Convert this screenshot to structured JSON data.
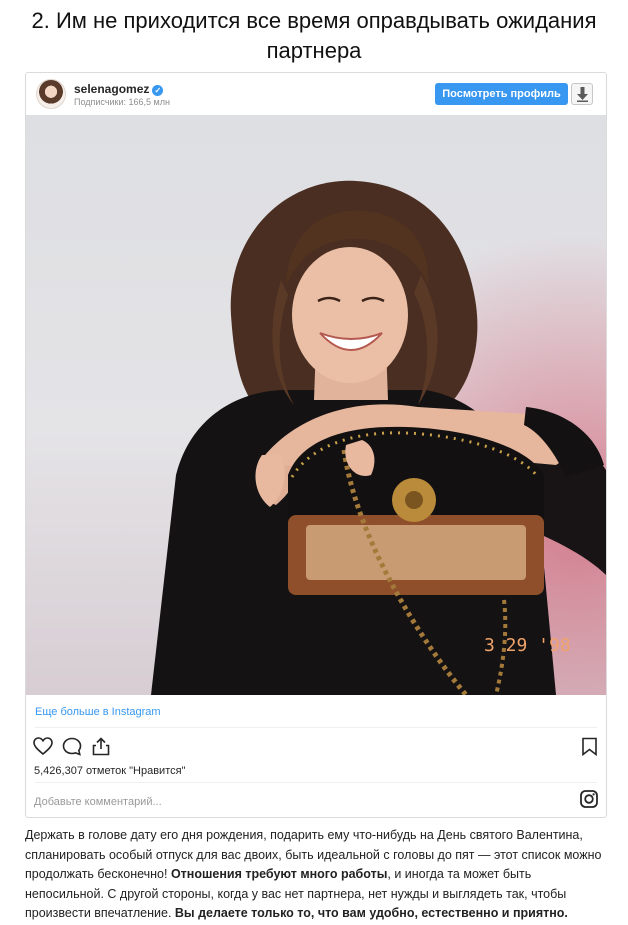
{
  "article": {
    "heading": "2. Им не приходится все время оправдывать ожидания партнера",
    "paragraph": {
      "part1": "Держать в голове дату его дня рождения, подарить ему что-нибудь на День святого Валентина, спланировать особый отпуск для вас двоих, быть идеальной с головы до пят — этот список можно продолжать бесконечно! ",
      "bold1": "Отношения требуют много работы",
      "part2": ", и иногда та может быть непосильной. С другой стороны, когда у вас нет партнера, нет нужды и выглядеть так, чтобы произвести впечатление. ",
      "bold2": "Вы делаете только то, что вам удобно, естественно и приятно."
    }
  },
  "embed": {
    "username": "selenagomez",
    "followers": "Подписчики: 166,5 млн",
    "view_profile_label": "Посмотреть профиль",
    "photo_stamp": "3 29 '98",
    "more_link": "Еще больше в Instagram",
    "likes": "5,426,307 отметок \"Нравится\"",
    "comment_placeholder": "Добавьте комментарий...",
    "icons": [
      "verified-icon",
      "download-icon",
      "heart-icon",
      "comment-icon",
      "share-icon",
      "bookmark-icon",
      "instagram-glyph-icon"
    ]
  },
  "colors": {
    "accent": "#3897f0",
    "border": "#dbdbdb",
    "muted": "#8e8e8e"
  }
}
